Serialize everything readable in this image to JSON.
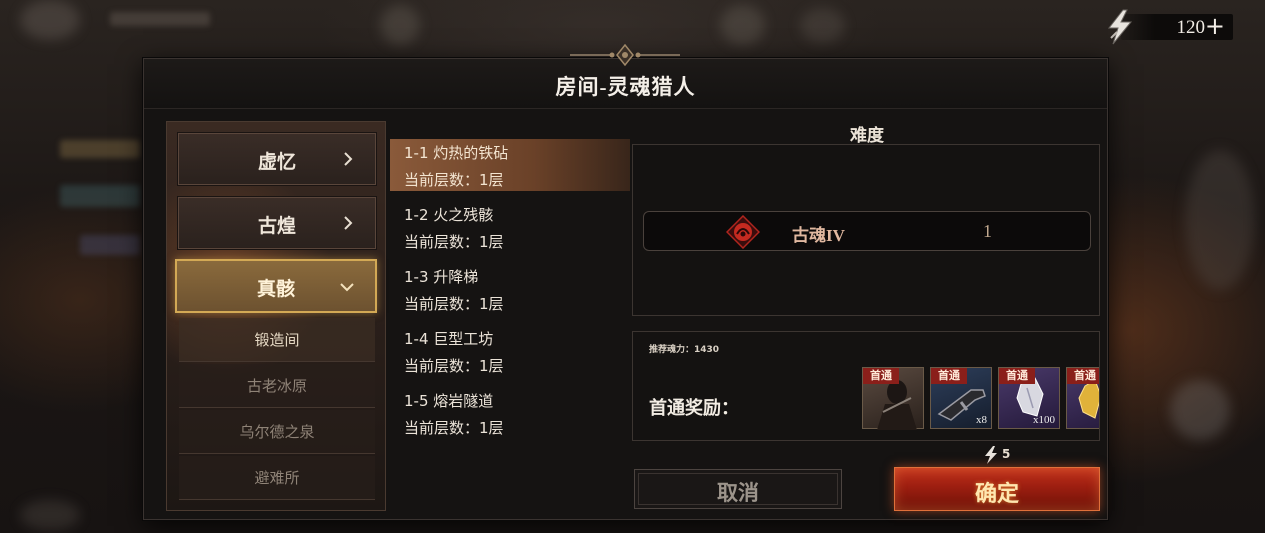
{
  "energy": {
    "value": "120",
    "plus_label": "+"
  },
  "dialog": {
    "title": "房间-灵魂猎人"
  },
  "categories": [
    {
      "label": "虚忆",
      "expanded": false
    },
    {
      "label": "古煌",
      "expanded": false
    },
    {
      "label": "真骸",
      "expanded": true
    }
  ],
  "sub_items": [
    {
      "label": "锻造间",
      "selected": true
    },
    {
      "label": "古老冰原",
      "selected": false
    },
    {
      "label": "乌尔德之泉",
      "selected": false
    },
    {
      "label": "避难所",
      "selected": false
    }
  ],
  "levels": [
    {
      "name": "1-1 灼热的铁砧",
      "floor": "当前层数：1层",
      "selected": true
    },
    {
      "name": "1-2 火之残骸",
      "floor": "当前层数：1层",
      "selected": false
    },
    {
      "name": "1-3 升降梯",
      "floor": "当前层数：1层",
      "selected": false
    },
    {
      "name": "1-4 巨型工坊",
      "floor": "当前层数：1层",
      "selected": false
    },
    {
      "name": "1-5 熔岩隧道",
      "floor": "当前层数：1层",
      "selected": false
    }
  ],
  "difficulty": {
    "title": "难度",
    "name": "古魂IV",
    "level": "1"
  },
  "rewards": {
    "recommend_text": "推荐魂力：1430",
    "label": "首通奖励：",
    "items": [
      {
        "tag": "首通",
        "qty": "",
        "icon": "character-portrait"
      },
      {
        "tag": "首通",
        "qty": "x8",
        "icon": "weapon-gun"
      },
      {
        "tag": "首通",
        "qty": "x100",
        "icon": "crystal-shard"
      },
      {
        "tag": "首通",
        "qty": "",
        "icon": "gold-crystal"
      }
    ]
  },
  "cost": {
    "value": "5"
  },
  "buttons": {
    "cancel": "取消",
    "confirm": "确定"
  },
  "colors": {
    "accent_gold": "#d3a955",
    "confirm_red": "#9c1e10",
    "selected_level": "#8a5a3a",
    "tag_red": "#8a1f1a"
  }
}
